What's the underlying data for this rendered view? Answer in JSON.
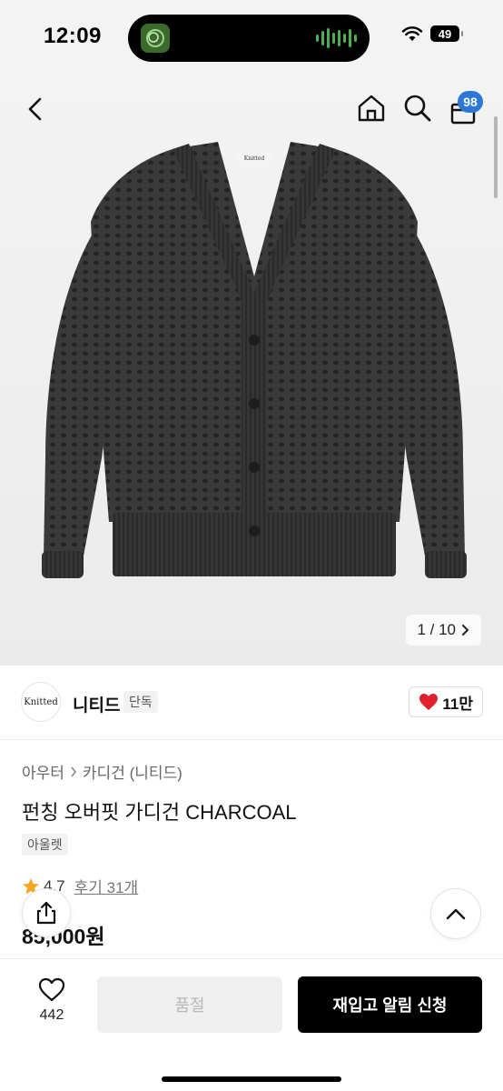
{
  "status": {
    "time": "12:09",
    "battery": "49"
  },
  "header": {
    "cart_count": "98",
    "icons": [
      "back-icon",
      "home-icon",
      "search-icon",
      "cart-icon"
    ]
  },
  "gallery": {
    "counter": "1 / 10",
    "label_on_garment": "Knitted"
  },
  "brand": {
    "logo_text": "Knitted",
    "name": "니티드",
    "badge": "단독",
    "likes": "11만"
  },
  "product": {
    "breadcrumb": [
      "아우터",
      "카디건 (니티드)"
    ],
    "title": "펀칭 오버핏 가디건 CHARCOAL",
    "tag": "아울렛",
    "rating": "4.7",
    "reviews": "후기 31개",
    "price": "85,000원"
  },
  "bottom": {
    "wish_count": "442",
    "soldout_label": "품절",
    "restock_label": "재입고 알림 신청"
  },
  "colors": {
    "accent_blue": "#2c78d6",
    "heart_red": "#e0202e",
    "star_orange": "#f5a623",
    "garment": "#3a3a3a"
  }
}
